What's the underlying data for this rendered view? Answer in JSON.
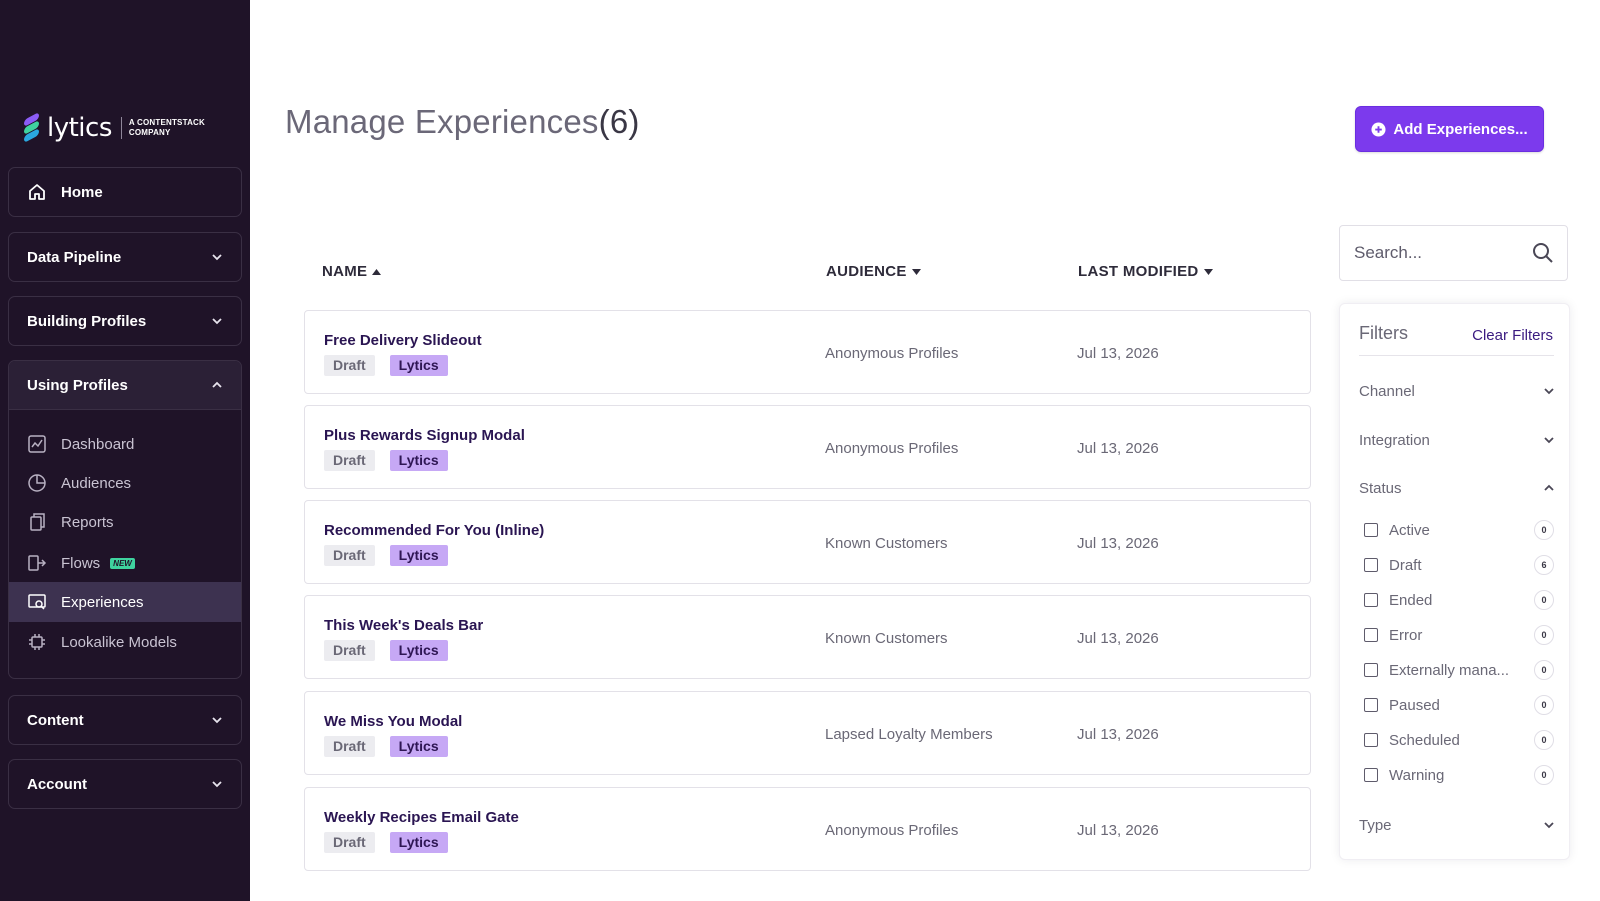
{
  "brand": {
    "logo_text": "lytics",
    "logo_sub_line1": "A CONTENTSTACK",
    "logo_sub_line2": "COMPANY",
    "colors": {
      "sidebar_bg": "#1f1328",
      "accent": "#7c3aed",
      "logo_top": "#8b5cf6",
      "logo_mid": "#3fd39f",
      "logo_bot": "#2aa8e0"
    }
  },
  "sidebar": {
    "home": {
      "label": "Home",
      "icon": "home-icon"
    },
    "data_pipeline": {
      "label": "Data Pipeline",
      "icon": "chevron-down-icon"
    },
    "building_profiles": {
      "label": "Building Profiles",
      "icon": "chevron-down-icon"
    },
    "using_profiles": {
      "label": "Using Profiles",
      "icon": "chevron-up-icon",
      "items": [
        {
          "label": "Dashboard",
          "icon": "dashboard-icon"
        },
        {
          "label": "Audiences",
          "icon": "pie-chart-icon"
        },
        {
          "label": "Reports",
          "icon": "reports-icon"
        },
        {
          "label": "Flows",
          "icon": "flows-icon",
          "badge": "NEW"
        },
        {
          "label": "Experiences",
          "icon": "experiences-icon",
          "active": true
        },
        {
          "label": "Lookalike Models",
          "icon": "chip-icon"
        }
      ]
    },
    "content": {
      "label": "Content",
      "icon": "chevron-down-icon"
    },
    "account": {
      "label": "Account",
      "icon": "chevron-down-icon"
    }
  },
  "main": {
    "title": "Manage Experiences",
    "count": "(6)",
    "add_button": "Add Experiences...",
    "columns": {
      "name": "NAME",
      "audience": "AUDIENCE",
      "last_modified": "LAST MODIFIED"
    },
    "rows": [
      {
        "name": "Free Delivery Slideout",
        "tags": [
          "Draft",
          "Lytics"
        ],
        "audience": "Anonymous Profiles",
        "modified": "Jul 13, 2026"
      },
      {
        "name": "Plus Rewards Signup Modal",
        "tags": [
          "Draft",
          "Lytics"
        ],
        "audience": "Anonymous Profiles",
        "modified": "Jul 13, 2026"
      },
      {
        "name": "Recommended For You (Inline)",
        "tags": [
          "Draft",
          "Lytics"
        ],
        "audience": "Known Customers",
        "modified": "Jul 13, 2026"
      },
      {
        "name": "This Week's Deals Bar",
        "tags": [
          "Draft",
          "Lytics"
        ],
        "audience": "Known Customers",
        "modified": "Jul 13, 2026"
      },
      {
        "name": "We Miss You Modal",
        "tags": [
          "Draft",
          "Lytics"
        ],
        "audience": "Lapsed Loyalty Members",
        "modified": "Jul 13, 2026"
      },
      {
        "name": "Weekly Recipes Email Gate",
        "tags": [
          "Draft",
          "Lytics"
        ],
        "audience": "Anonymous Profiles",
        "modified": "Jul 13, 2026"
      }
    ]
  },
  "search": {
    "placeholder": "Search..."
  },
  "filters": {
    "title": "Filters",
    "clear": "Clear Filters",
    "sections": {
      "channel": "Channel",
      "integration": "Integration",
      "status": "Status",
      "type": "Type"
    },
    "status_options": [
      {
        "label": "Active",
        "count": "0"
      },
      {
        "label": "Draft",
        "count": "6"
      },
      {
        "label": "Ended",
        "count": "0"
      },
      {
        "label": "Error",
        "count": "0"
      },
      {
        "label": "Externally mana...",
        "count": "0"
      },
      {
        "label": "Paused",
        "count": "0"
      },
      {
        "label": "Scheduled",
        "count": "0"
      },
      {
        "label": "Warning",
        "count": "0"
      }
    ]
  }
}
